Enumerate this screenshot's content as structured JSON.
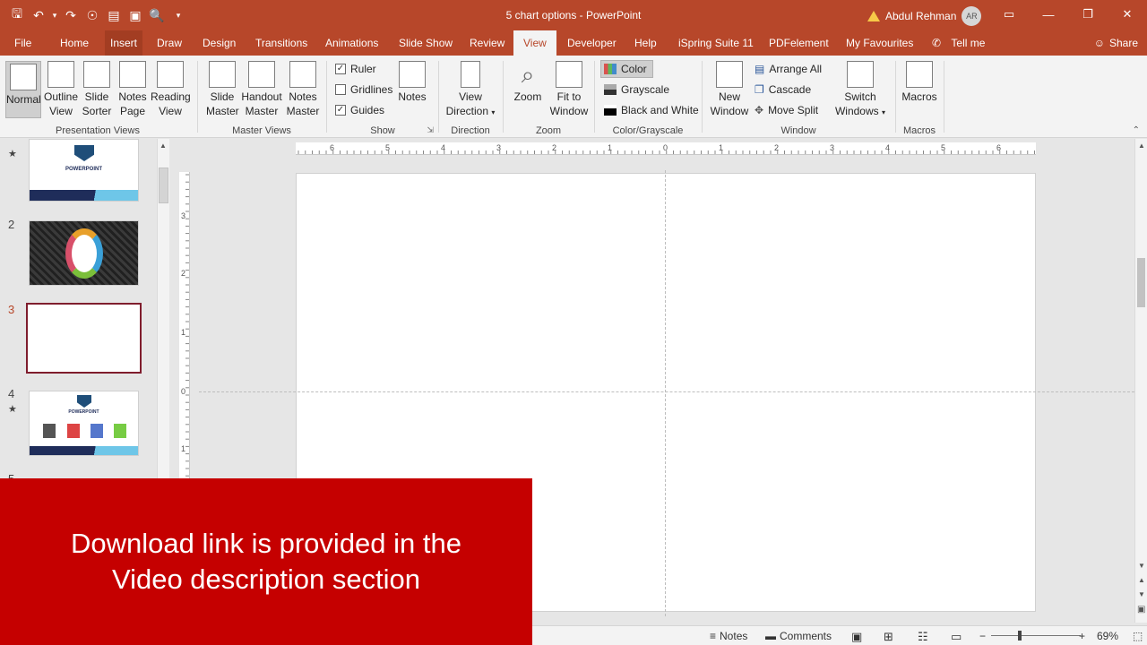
{
  "titlebar": {
    "title": "5 chart options  -  PowerPoint",
    "user_name": "Abdul Rehman",
    "avatar_initials": "AR"
  },
  "tabs": [
    "File",
    "Home",
    "Insert",
    "Draw",
    "Design",
    "Transitions",
    "Animations",
    "Slide Show",
    "Review",
    "View",
    "Developer",
    "Help",
    "iSpring Suite 11",
    "PDFelement",
    "My Favourites",
    "Tell me"
  ],
  "active_tab": "View",
  "share_label": "Share",
  "ribbon": {
    "presentation_views": {
      "label": "Presentation Views",
      "normal": "Normal",
      "outline": [
        "Outline",
        "View"
      ],
      "sorter": [
        "Slide",
        "Sorter"
      ],
      "notes_page": [
        "Notes",
        "Page"
      ],
      "reading": [
        "Reading",
        "View"
      ]
    },
    "master_views": {
      "label": "Master Views",
      "slide_master": [
        "Slide",
        "Master"
      ],
      "handout_master": [
        "Handout",
        "Master"
      ],
      "notes_master": [
        "Notes",
        "Master"
      ]
    },
    "show": {
      "label": "Show",
      "ruler": "Ruler",
      "gridlines": "Gridlines",
      "guides": "Guides",
      "notes": "Notes"
    },
    "direction": {
      "label": "Direction",
      "view_direction": [
        "View",
        "Direction"
      ]
    },
    "zoom": {
      "label": "Zoom",
      "zoom": "Zoom",
      "fit": [
        "Fit to",
        "Window"
      ]
    },
    "color_grayscale": {
      "label": "Color/Grayscale",
      "color": "Color",
      "grayscale": "Grayscale",
      "bw": "Black and White"
    },
    "window": {
      "label": "Window",
      "new_window": [
        "New",
        "Window"
      ],
      "arrange_all": "Arrange All",
      "cascade": "Cascade",
      "move_split": "Move Split",
      "switch": [
        "Switch",
        "Windows"
      ]
    },
    "macros": {
      "label": "Macros",
      "macros": "Macros"
    }
  },
  "slides": {
    "numbers": [
      "2",
      "3",
      "4",
      "5"
    ],
    "thumb1_text": "POWERPOINT",
    "thumb4_text": "POWERPOINT"
  },
  "ruler": {
    "h_labels": [
      "6",
      "5",
      "4",
      "3",
      "2",
      "1",
      "0",
      "1",
      "2",
      "3",
      "4",
      "5",
      "6"
    ],
    "v_labels": [
      "3",
      "2",
      "1",
      "0",
      "1"
    ]
  },
  "banner": {
    "line1": "Download link is provided in the",
    "line2": "Video description section"
  },
  "status": {
    "notes": "Notes",
    "comments": "Comments",
    "zoom": "69%"
  },
  "colors": {
    "accent": "#b7472a",
    "banner": "#c50000",
    "selected_slide_border": "#7f1d2d"
  }
}
